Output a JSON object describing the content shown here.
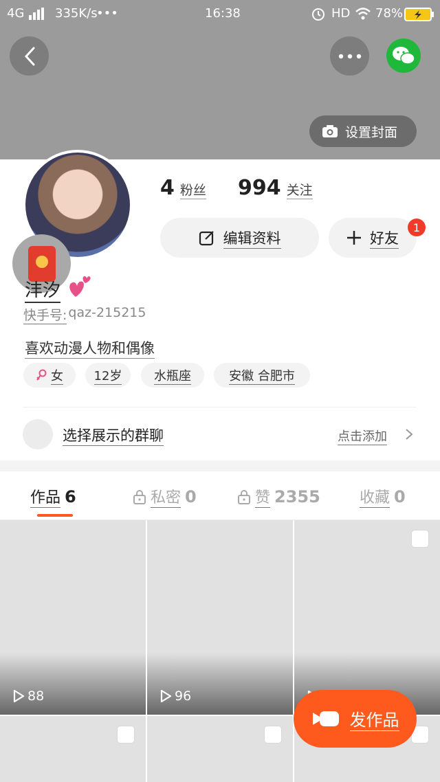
{
  "status_bar": {
    "network": "4G",
    "speed": "335K/s",
    "dots": "•••",
    "time": "16:38",
    "hd": "HD",
    "battery": "78%"
  },
  "header": {
    "set_cover_label": "设置封面"
  },
  "profile": {
    "fans_count": "4",
    "fans_label": "粉丝",
    "following_count": "994",
    "following_label": "关注",
    "edit_profile_label": "编辑资料",
    "add_friend_label": "好友",
    "friend_badge": "1",
    "nickname": "沣汐",
    "id_label": "快手号:",
    "id_value": "qaz-215215",
    "bio": "喜欢动漫人物和偶像",
    "tags": [
      "女",
      "12岁",
      "水瓶座",
      "安徽 合肥市"
    ]
  },
  "group_chat": {
    "label": "选择展示的群聊",
    "action": "点击添加"
  },
  "tabs": [
    {
      "label": "作品",
      "count": "6"
    },
    {
      "label": "私密",
      "count": "0"
    },
    {
      "label": "赞",
      "count": "2355"
    },
    {
      "label": "收藏",
      "count": "0"
    }
  ],
  "videos": [
    {
      "plays": "88"
    },
    {
      "plays": "96"
    },
    {
      "plays": ""
    }
  ],
  "publish_label": "发作品",
  "colors": {
    "accent": "#fe5a1d",
    "cover": "#9b9b9b",
    "wechat": "#1fb83a",
    "badge": "#f03a2a"
  }
}
